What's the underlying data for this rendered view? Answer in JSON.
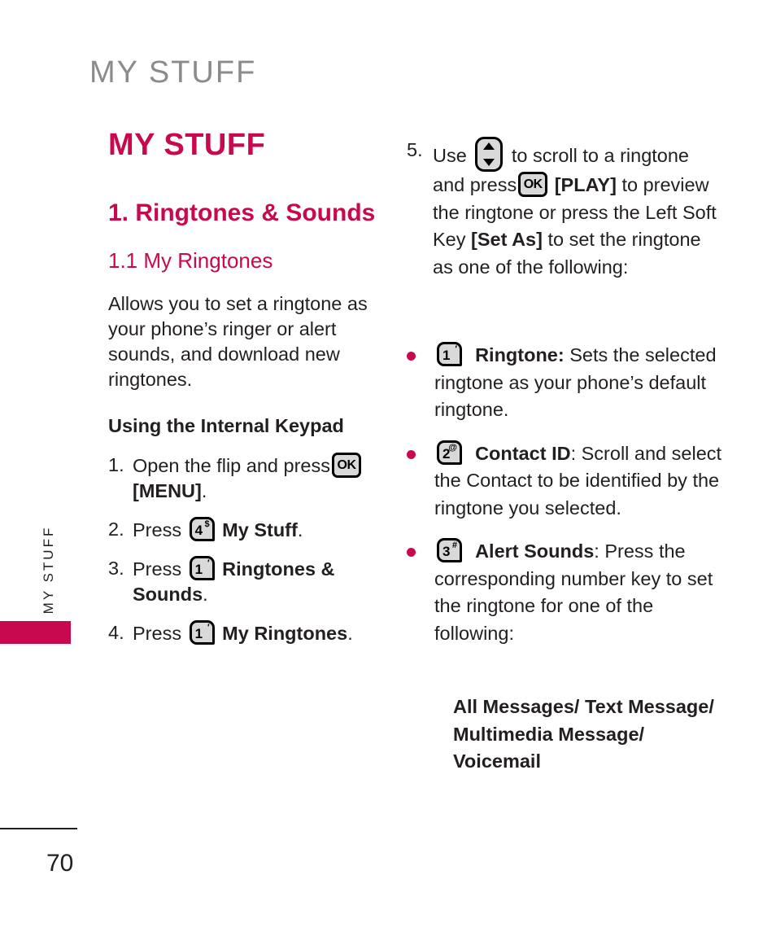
{
  "running_head": "MY STUFF",
  "side_tab": "MY STUFF",
  "page_number": "70",
  "colors": {
    "accent": "#c9094f",
    "running_head_gray": "#8b8b8b",
    "body_text": "#231f20",
    "key_fill": "#d9d9d9"
  },
  "left_column": {
    "h1": "MY STUFF",
    "h2": "1. Ringtones & Sounds",
    "h3": "1.1 My Ringtones",
    "intro": "Allows you to set a ringtone as your phone’s ringer or alert sounds, and download new ringtones.",
    "subhead": "Using the Internal Keypad",
    "steps": [
      {
        "number": "1.",
        "text_before": "Open the flip and press",
        "icon": "ok-key-icon",
        "icon_label": "OK",
        "text_after_bold": "[MENU]",
        "text_end": "."
      },
      {
        "number": "2.",
        "text_before": "Press",
        "icon": "key-4-icon",
        "icon_digit": "4",
        "icon_sup": "$",
        "text_after_bold": "My Stuff",
        "text_end": "."
      },
      {
        "number": "3.",
        "text_before": "Press",
        "icon": "key-1-icon",
        "icon_digit": "1",
        "icon_sup": "′",
        "text_after_bold": "Ringtones & Sounds",
        "text_end": "."
      },
      {
        "number": "4.",
        "text_before": "Press",
        "icon": "key-1-icon",
        "icon_digit": "1",
        "icon_sup": "′",
        "text_after_bold": "My Ringtones",
        "text_end": "."
      }
    ]
  },
  "right_column": {
    "step5": {
      "number": "5.",
      "part1": "Use",
      "nav_icon": "nav-updown-key-icon",
      "part2": "to scroll to a ringtone and press",
      "ok_icon": "ok-key-icon",
      "ok_label": "OK",
      "bold1": "[PLAY]",
      "part3": "to preview the ringtone or press the Left Soft Key",
      "bold2": "[Set As]",
      "part4": "to set the ringtone as one of the following:"
    },
    "bullets": [
      {
        "icon_digit": "1",
        "icon_sup": "′",
        "icon_name": "key-1-icon",
        "label": "Ringtone:",
        "text": " Sets the selected ringtone as your phone’s default ringtone."
      },
      {
        "icon_digit": "2",
        "icon_sup": "@",
        "icon_name": "key-2-icon",
        "label": "Contact ID",
        "text": ": Scroll and select the Contact to be identified by the ringtone you selected."
      },
      {
        "icon_digit": "3",
        "icon_sup": "#",
        "icon_name": "key-3-icon",
        "label": "Alert Sounds",
        "text": ": Press the corresponding number key to set the ringtone for one of the following:"
      }
    ],
    "alert_sound_options": "All Messages/ Text Message/ Multimedia Message/ Voicemail"
  }
}
